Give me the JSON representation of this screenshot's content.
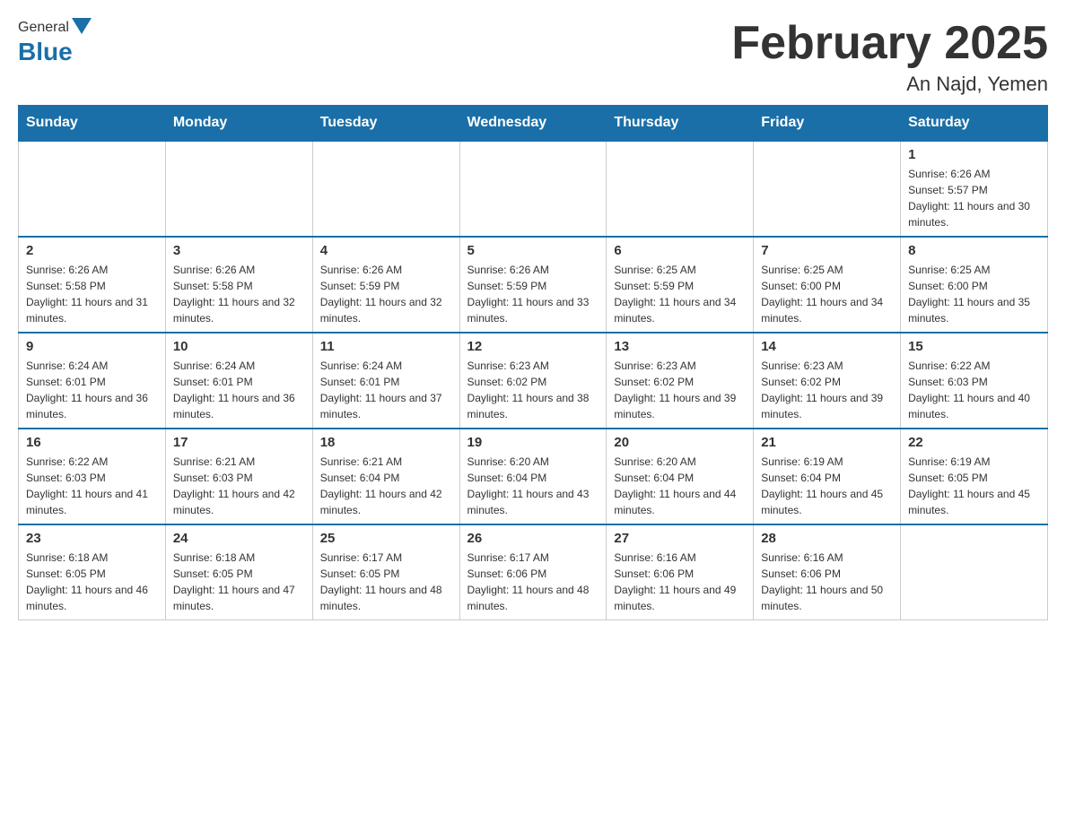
{
  "header": {
    "title": "February 2025",
    "subtitle": "An Najd, Yemen"
  },
  "logo": {
    "general": "General",
    "blue": "Blue"
  },
  "days": [
    "Sunday",
    "Monday",
    "Tuesday",
    "Wednesday",
    "Thursday",
    "Friday",
    "Saturday"
  ],
  "weeks": [
    [
      {
        "day": "",
        "info": ""
      },
      {
        "day": "",
        "info": ""
      },
      {
        "day": "",
        "info": ""
      },
      {
        "day": "",
        "info": ""
      },
      {
        "day": "",
        "info": ""
      },
      {
        "day": "",
        "info": ""
      },
      {
        "day": "1",
        "info": "Sunrise: 6:26 AM\nSunset: 5:57 PM\nDaylight: 11 hours and 30 minutes."
      }
    ],
    [
      {
        "day": "2",
        "info": "Sunrise: 6:26 AM\nSunset: 5:58 PM\nDaylight: 11 hours and 31 minutes."
      },
      {
        "day": "3",
        "info": "Sunrise: 6:26 AM\nSunset: 5:58 PM\nDaylight: 11 hours and 32 minutes."
      },
      {
        "day": "4",
        "info": "Sunrise: 6:26 AM\nSunset: 5:59 PM\nDaylight: 11 hours and 32 minutes."
      },
      {
        "day": "5",
        "info": "Sunrise: 6:26 AM\nSunset: 5:59 PM\nDaylight: 11 hours and 33 minutes."
      },
      {
        "day": "6",
        "info": "Sunrise: 6:25 AM\nSunset: 5:59 PM\nDaylight: 11 hours and 34 minutes."
      },
      {
        "day": "7",
        "info": "Sunrise: 6:25 AM\nSunset: 6:00 PM\nDaylight: 11 hours and 34 minutes."
      },
      {
        "day": "8",
        "info": "Sunrise: 6:25 AM\nSunset: 6:00 PM\nDaylight: 11 hours and 35 minutes."
      }
    ],
    [
      {
        "day": "9",
        "info": "Sunrise: 6:24 AM\nSunset: 6:01 PM\nDaylight: 11 hours and 36 minutes."
      },
      {
        "day": "10",
        "info": "Sunrise: 6:24 AM\nSunset: 6:01 PM\nDaylight: 11 hours and 36 minutes."
      },
      {
        "day": "11",
        "info": "Sunrise: 6:24 AM\nSunset: 6:01 PM\nDaylight: 11 hours and 37 minutes."
      },
      {
        "day": "12",
        "info": "Sunrise: 6:23 AM\nSunset: 6:02 PM\nDaylight: 11 hours and 38 minutes."
      },
      {
        "day": "13",
        "info": "Sunrise: 6:23 AM\nSunset: 6:02 PM\nDaylight: 11 hours and 39 minutes."
      },
      {
        "day": "14",
        "info": "Sunrise: 6:23 AM\nSunset: 6:02 PM\nDaylight: 11 hours and 39 minutes."
      },
      {
        "day": "15",
        "info": "Sunrise: 6:22 AM\nSunset: 6:03 PM\nDaylight: 11 hours and 40 minutes."
      }
    ],
    [
      {
        "day": "16",
        "info": "Sunrise: 6:22 AM\nSunset: 6:03 PM\nDaylight: 11 hours and 41 minutes."
      },
      {
        "day": "17",
        "info": "Sunrise: 6:21 AM\nSunset: 6:03 PM\nDaylight: 11 hours and 42 minutes."
      },
      {
        "day": "18",
        "info": "Sunrise: 6:21 AM\nSunset: 6:04 PM\nDaylight: 11 hours and 42 minutes."
      },
      {
        "day": "19",
        "info": "Sunrise: 6:20 AM\nSunset: 6:04 PM\nDaylight: 11 hours and 43 minutes."
      },
      {
        "day": "20",
        "info": "Sunrise: 6:20 AM\nSunset: 6:04 PM\nDaylight: 11 hours and 44 minutes."
      },
      {
        "day": "21",
        "info": "Sunrise: 6:19 AM\nSunset: 6:04 PM\nDaylight: 11 hours and 45 minutes."
      },
      {
        "day": "22",
        "info": "Sunrise: 6:19 AM\nSunset: 6:05 PM\nDaylight: 11 hours and 45 minutes."
      }
    ],
    [
      {
        "day": "23",
        "info": "Sunrise: 6:18 AM\nSunset: 6:05 PM\nDaylight: 11 hours and 46 minutes."
      },
      {
        "day": "24",
        "info": "Sunrise: 6:18 AM\nSunset: 6:05 PM\nDaylight: 11 hours and 47 minutes."
      },
      {
        "day": "25",
        "info": "Sunrise: 6:17 AM\nSunset: 6:05 PM\nDaylight: 11 hours and 48 minutes."
      },
      {
        "day": "26",
        "info": "Sunrise: 6:17 AM\nSunset: 6:06 PM\nDaylight: 11 hours and 48 minutes."
      },
      {
        "day": "27",
        "info": "Sunrise: 6:16 AM\nSunset: 6:06 PM\nDaylight: 11 hours and 49 minutes."
      },
      {
        "day": "28",
        "info": "Sunrise: 6:16 AM\nSunset: 6:06 PM\nDaylight: 11 hours and 50 minutes."
      },
      {
        "day": "",
        "info": ""
      }
    ]
  ]
}
